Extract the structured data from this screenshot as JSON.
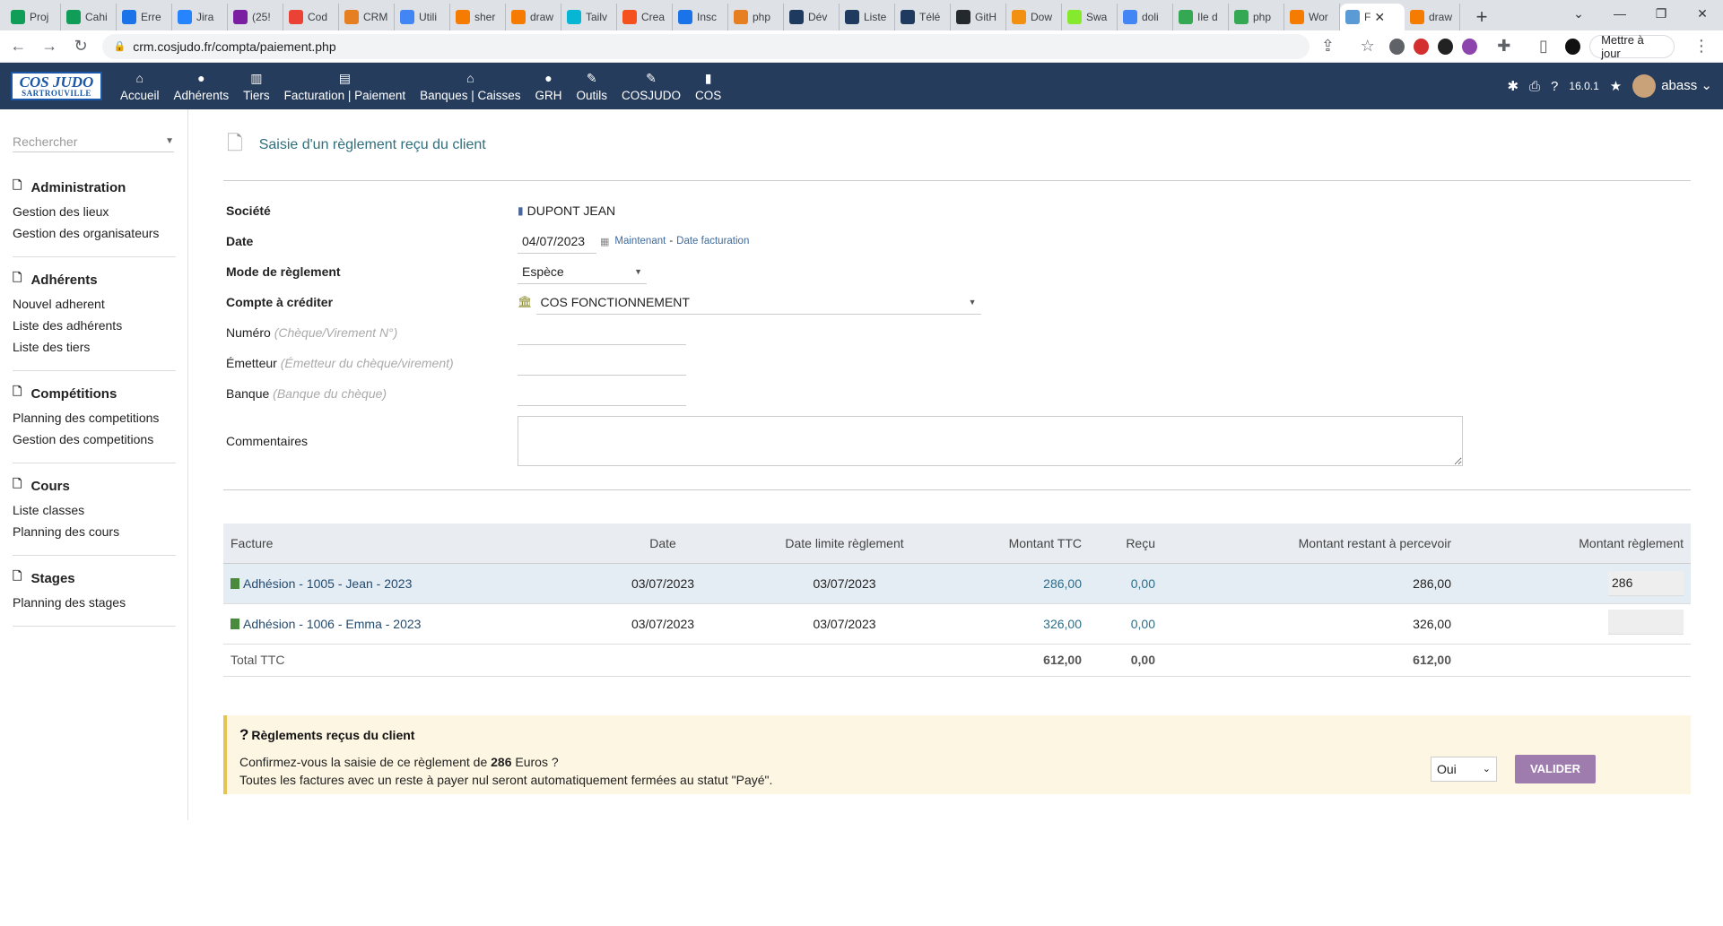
{
  "browser": {
    "tabs": [
      {
        "label": "Proj",
        "color": "#0f9d58"
      },
      {
        "label": "Cahi",
        "color": "#0f9d58"
      },
      {
        "label": "Erre",
        "color": "#1a73e8"
      },
      {
        "label": "Jira",
        "color": "#2684ff"
      },
      {
        "label": "(25!",
        "color": "#7b1fa2"
      },
      {
        "label": "Cod",
        "color": "#ea4335"
      },
      {
        "label": "CRM",
        "color": "#e67e22"
      },
      {
        "label": "Utili",
        "color": "#4285f4"
      },
      {
        "label": "sher",
        "color": "#f57c00"
      },
      {
        "label": "draw",
        "color": "#f57c00"
      },
      {
        "label": "Tailv",
        "color": "#06b6d4"
      },
      {
        "label": "Crea",
        "color": "#f4511e"
      },
      {
        "label": "Insc",
        "color": "#1a73e8"
      },
      {
        "label": "php",
        "color": "#e67e22"
      },
      {
        "label": "Dév",
        "color": "#1e3a5f"
      },
      {
        "label": "Liste",
        "color": "#1e3a5f"
      },
      {
        "label": "Télé",
        "color": "#1e3a5f"
      },
      {
        "label": "GitH",
        "color": "#24292e"
      },
      {
        "label": "Dow",
        "color": "#f29111"
      },
      {
        "label": "Swa",
        "color": "#85ea2d"
      },
      {
        "label": "doli",
        "color": "#4285f4"
      },
      {
        "label": "Ile d",
        "color": "#34a853"
      },
      {
        "label": "php",
        "color": "#34a853"
      },
      {
        "label": "Wor",
        "color": "#f57c00"
      },
      {
        "label": "F",
        "color": "#5a9bd5",
        "active": true
      },
      {
        "label": "draw",
        "color": "#f57c00"
      }
    ],
    "new_tab": "+",
    "url": "crm.cosjudo.fr/compta/paiement.php",
    "update_button": "Mettre à jour"
  },
  "logo": {
    "line1": "COS JUDO",
    "line2": "SARTROUVILLE"
  },
  "nav": [
    {
      "label": "Accueil",
      "icon": "⌂"
    },
    {
      "label": "Adhérents",
      "icon": "●"
    },
    {
      "label": "Tiers",
      "icon": "▥"
    },
    {
      "label": "Facturation | Paiement",
      "icon": "▤"
    },
    {
      "label": "Banques | Caisses",
      "icon": "⌂"
    },
    {
      "label": "GRH",
      "icon": "●"
    },
    {
      "label": "Outils",
      "icon": "✎"
    },
    {
      "label": "COSJUDO",
      "icon": "✎"
    },
    {
      "label": "COS",
      "icon": "▮"
    }
  ],
  "topright": {
    "version": "16.0.1",
    "username": "abass"
  },
  "sidebar": {
    "search_placeholder": "Rechercher",
    "sections": [
      {
        "title": "Administration",
        "items": [
          "Gestion des lieux",
          "Gestion des organisateurs"
        ]
      },
      {
        "title": "Adhérents",
        "items": [
          "Nouvel adherent",
          "Liste des adhérents",
          "Liste des tiers"
        ]
      },
      {
        "title": "Compétitions",
        "items": [
          "Planning des competitions",
          "Gestion des competitions"
        ]
      },
      {
        "title": "Cours",
        "items": [
          "Liste classes",
          "Planning des cours"
        ]
      },
      {
        "title": "Stages",
        "items": [
          "Planning des stages"
        ]
      }
    ]
  },
  "page": {
    "title": "Saisie d'un règlement reçu du client",
    "fields": {
      "societe_label": "Société",
      "societe_value": "DUPONT JEAN",
      "date_label": "Date",
      "date_value": "04/07/2023",
      "date_now_link": "Maintenant",
      "date_sep": "-",
      "date_invoice_link": "Date facturation",
      "mode_label": "Mode de règlement",
      "mode_value": "Espèce",
      "compte_label": "Compte à créditer",
      "compte_value": "COS FONCTIONNEMENT",
      "numero_label": "Numéro",
      "numero_hint": "(Chèque/Virement N°)",
      "emetteur_label": "Émetteur",
      "emetteur_hint": "(Émetteur du chèque/virement)",
      "banque_label": "Banque",
      "banque_hint": "(Banque du chèque)",
      "commentaires_label": "Commentaires"
    },
    "table": {
      "headers": {
        "facture": "Facture",
        "date": "Date",
        "date_limite": "Date limite règlement",
        "montant_ttc": "Montant TTC",
        "recu": "Reçu",
        "restant": "Montant restant à percevoir",
        "montant_reglement": "Montant règlement"
      },
      "rows": [
        {
          "facture": "Adhésion - 1005 - Jean - 2023",
          "date": "03/07/2023",
          "date_limite": "03/07/2023",
          "montant_ttc": "286,00",
          "recu": "0,00",
          "restant": "286,00",
          "reglement": "286"
        },
        {
          "facture": "Adhésion - 1006 - Emma - 2023",
          "date": "03/07/2023",
          "date_limite": "03/07/2023",
          "montant_ttc": "326,00",
          "recu": "0,00",
          "restant": "326,00",
          "reglement": ""
        }
      ],
      "total": {
        "label": "Total TTC",
        "montant_ttc": "612,00",
        "recu": "0,00",
        "restant": "612,00"
      }
    },
    "confirm": {
      "title": "Règlements reçus du client",
      "line1_prefix": "Confirmez-vous la saisie de ce règlement de ",
      "line1_amount": "286",
      "line1_suffix": " Euros ?",
      "line2": "Toutes les factures avec un reste à payer nul seront automatiquement fermées au statut \"Payé\".",
      "select_value": "Oui",
      "submit": "VALIDER"
    }
  }
}
